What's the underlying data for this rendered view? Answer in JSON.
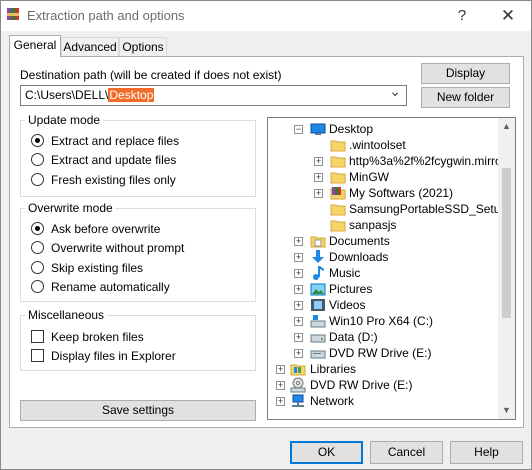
{
  "window": {
    "title": "Extraction path and options",
    "help_glyph": "?",
    "close_glyph": "✕",
    "icon": "winrar-books-icon"
  },
  "tabs": [
    {
      "label": "General",
      "active": true
    },
    {
      "label": "Advanced",
      "active": false
    },
    {
      "label": "Options",
      "active": false
    }
  ],
  "destination": {
    "label": "Destination path (will be created if does not exist)",
    "path_prefix": "C:\\Users\\DELL\\",
    "path_selected": "Desktop",
    "dropdown_glyph": "⌄"
  },
  "buttons": {
    "display": "Display",
    "new_folder": "New folder",
    "save_settings": "Save settings"
  },
  "update_mode": {
    "title": "Update mode",
    "options": [
      {
        "label": "Extract and replace files",
        "checked": true
      },
      {
        "label": "Extract and update files",
        "checked": false
      },
      {
        "label": "Fresh existing files only",
        "checked": false
      }
    ]
  },
  "overwrite_mode": {
    "title": "Overwrite mode",
    "options": [
      {
        "label": "Ask before overwrite",
        "checked": true
      },
      {
        "label": "Overwrite without prompt",
        "checked": false
      },
      {
        "label": "Skip existing files",
        "checked": false
      },
      {
        "label": "Rename automatically",
        "checked": false
      }
    ]
  },
  "miscellaneous": {
    "title": "Miscellaneous",
    "options": [
      {
        "label": "Keep broken files",
        "checked": false
      },
      {
        "label": "Display files in Explorer",
        "checked": false
      }
    ]
  },
  "tree": {
    "items": [
      {
        "label": "Desktop",
        "icon": "desktop-icon",
        "expander": "−",
        "selected": true
      },
      {
        "label": ".wintoolset",
        "icon": "folder-icon",
        "expander": ""
      },
      {
        "label": "http%3a%2f%2fcygwin.mirro",
        "icon": "folder-icon",
        "expander": "+"
      },
      {
        "label": "MinGW",
        "icon": "folder-icon",
        "expander": "+"
      },
      {
        "label": "My Softwars (2021)",
        "icon": "winrar-archive-folder-icon",
        "expander": "+"
      },
      {
        "label": "SamsungPortableSSD_Setup_W",
        "icon": "folder-icon",
        "expander": ""
      },
      {
        "label": "sanpasjs",
        "icon": "folder-icon",
        "expander": ""
      },
      {
        "label": "Documents",
        "icon": "documents-icon",
        "expander": "+"
      },
      {
        "label": "Downloads",
        "icon": "downloads-icon",
        "expander": "+"
      },
      {
        "label": "Music",
        "icon": "music-icon",
        "expander": "+"
      },
      {
        "label": "Pictures",
        "icon": "pictures-icon",
        "expander": "+"
      },
      {
        "label": "Videos",
        "icon": "videos-icon",
        "expander": "+"
      },
      {
        "label": "Win10 Pro X64 (C:)",
        "icon": "system-drive-icon",
        "expander": "+"
      },
      {
        "label": "Data (D:)",
        "icon": "drive-icon",
        "expander": "+"
      },
      {
        "label": "DVD RW Drive (E:)",
        "icon": "dvd-drive-icon",
        "expander": "+"
      },
      {
        "label": "Libraries",
        "icon": "libraries-icon",
        "expander": "+"
      },
      {
        "label": "DVD RW Drive (E:)",
        "icon": "dvd-drive-icon",
        "expander": "+"
      },
      {
        "label": "Network",
        "icon": "network-icon",
        "expander": "+"
      }
    ],
    "scroll_up_glyph": "▲",
    "scroll_down_glyph": "▼"
  },
  "footer": {
    "ok": "OK",
    "cancel": "Cancel",
    "help": "Help"
  },
  "colors": {
    "selection_highlight": "#f26b27",
    "default_button_border": "#0078d7",
    "folder_yellow": "#f5d56b",
    "desktop_blue": "#1e88e5"
  }
}
